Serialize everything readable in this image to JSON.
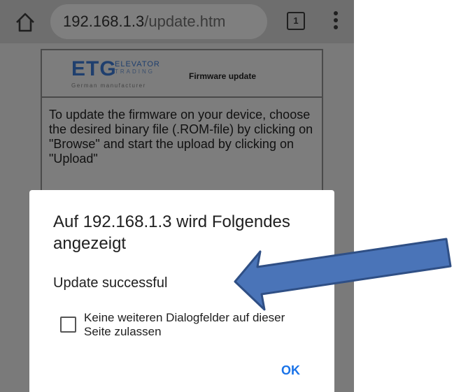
{
  "browser": {
    "url_host": "192.168.1.3",
    "url_path": "/update.htm",
    "tab_count": "1"
  },
  "page": {
    "logo": {
      "brand": "ETG",
      "line1": "ELEVATOR",
      "line2": "TRADING",
      "tagline": "German manufacturer"
    },
    "title": "Firmware update",
    "description": "To update the firmware on your device, choose the desired binary file (.ROM-file) by clicking on \"Browse\" and start the upload by clicking on \"Upload\""
  },
  "dialog": {
    "title": "Auf 192.168.1.3 wird Folgendes angezeigt",
    "message": "Update successful",
    "checkbox_label": "Keine weiteren Dialogfelder auf dieser Seite zulassen",
    "checkbox_checked": false,
    "ok_label": "OK"
  },
  "colors": {
    "arrow_fill": "#4a74b8",
    "arrow_stroke": "#2f4f85",
    "ok_text": "#1a73e8"
  }
}
